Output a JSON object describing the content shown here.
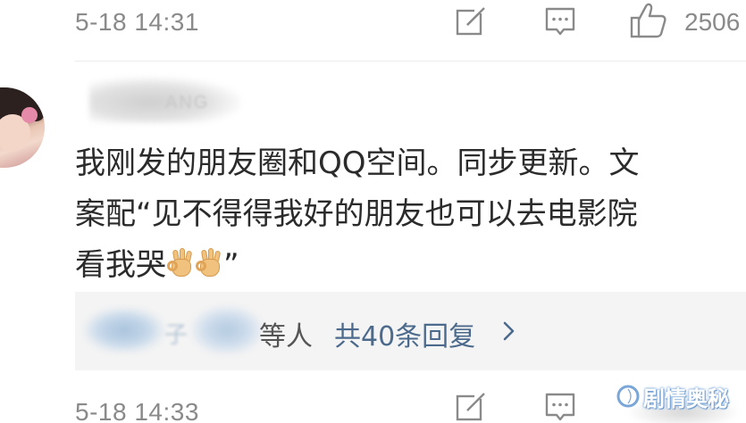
{
  "top_meta": {
    "timestamp": "5-18 14:31",
    "like_count": "2506"
  },
  "comment": {
    "username_partial": "ANG",
    "text_line1": "我刚发的朋友圈和QQ空间。同步更新。文",
    "text_line2": "案配“见不得得我好的朋友也可以去电影院",
    "text_line3_start": "看我哭",
    "text_line3_end": "”",
    "emoji": "ok-hand-icon"
  },
  "replies": {
    "replier_partial": "子",
    "suffix": "等人",
    "link": "共40条回复"
  },
  "bottom_meta": {
    "timestamp": "5-18 14:33"
  },
  "watermark": {
    "text": "剧情奥秘"
  },
  "colors": {
    "meta_gray": "#8a8a8a",
    "link_blue": "#4c6a8c",
    "reply_bg": "#f4f4f4",
    "watermark_blue": "#7aa6d8"
  }
}
